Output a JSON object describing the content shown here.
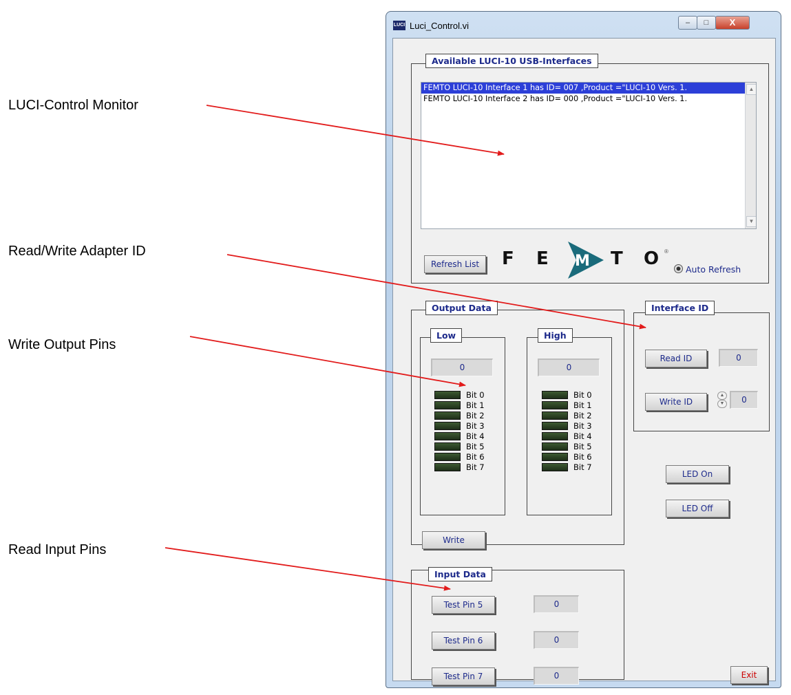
{
  "annotations": {
    "monitor": "LUCI-Control Monitor",
    "adapter_id": "Read/Write Adapter ID",
    "output_pins": "Write Output Pins",
    "input_pins": "Read Input Pins"
  },
  "window": {
    "icon_text": "LUCI",
    "title": "Luci_Control.vi",
    "controls": {
      "minimize": "–",
      "maximize": "□",
      "close": "X"
    }
  },
  "interfaces": {
    "label": "Available LUCI-10 USB-Interfaces",
    "items": [
      "FEMTO LUCI-10 Interface 1 has ID= 007 ,Product =\"LUCI-10  Vers. 1.",
      "FEMTO LUCI-10 Interface 2 has ID= 000 ,Product =\"LUCI-10  Vers. 1."
    ],
    "selected_index": 0,
    "refresh_label": "Refresh List",
    "auto_refresh_label": "Auto Refresh",
    "logo_text": "F E M T O"
  },
  "output": {
    "label": "Output Data",
    "low": {
      "label": "Low",
      "value": "0"
    },
    "high": {
      "label": "High",
      "value": "0"
    },
    "bits": [
      "Bit 0",
      "Bit 1",
      "Bit 2",
      "Bit 3",
      "Bit 4",
      "Bit 5",
      "Bit 6",
      "Bit 7"
    ],
    "write_label": "Write"
  },
  "interface_id": {
    "label": "Interface ID",
    "read_label": "Read ID",
    "read_value": "0",
    "write_label": "Write ID",
    "write_value": "0"
  },
  "led": {
    "on_label": "LED On",
    "off_label": "LED Off"
  },
  "input": {
    "label": "Input Data",
    "pins": [
      {
        "label": "Test Pin 5",
        "value": "0"
      },
      {
        "label": "Test Pin 6",
        "value": "0"
      },
      {
        "label": "Test Pin 7",
        "value": "0"
      }
    ]
  },
  "exit_label": "Exit",
  "colors": {
    "arrow": "#e21b1b",
    "accent_text": "#1d2a8b",
    "selection": "#2c3fd8"
  }
}
